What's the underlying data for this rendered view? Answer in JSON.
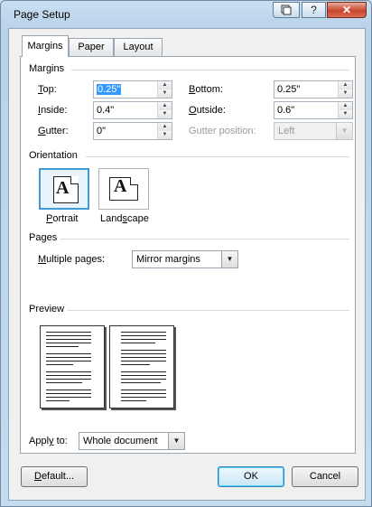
{
  "window": {
    "title": "Page Setup",
    "options_icon": "options-icon",
    "help_label": "?",
    "close_label": "✕"
  },
  "tabs": [
    {
      "label": "Margins",
      "active": true
    },
    {
      "label": "Paper",
      "active": false
    },
    {
      "label": "Layout",
      "active": false
    }
  ],
  "margins": {
    "section_label": "Margins",
    "top": {
      "label": "Top:",
      "value": "0.25\""
    },
    "bottom": {
      "label": "Bottom:",
      "value": "0.25\""
    },
    "inside": {
      "label": "Inside:",
      "value": "0.4\""
    },
    "outside": {
      "label": "Outside:",
      "value": "0.6\""
    },
    "gutter": {
      "label": "Gutter:",
      "value": "0\""
    },
    "gutter_position": {
      "label": "Gutter position:",
      "value": "Left",
      "disabled": true
    }
  },
  "orientation": {
    "section_label": "Orientation",
    "portrait_label": "Portrait",
    "landscape_label": "Landscape",
    "glyph": "A",
    "selected": "Portrait"
  },
  "pages": {
    "section_label": "Pages",
    "multiple_pages_label": "Multiple pages:",
    "multiple_pages_value": "Mirror margins"
  },
  "preview": {
    "section_label": "Preview"
  },
  "apply_to": {
    "label": "Apply to:",
    "value": "Whole document"
  },
  "buttons": {
    "default_label": "Default...",
    "ok_label": "OK",
    "cancel_label": "Cancel"
  }
}
